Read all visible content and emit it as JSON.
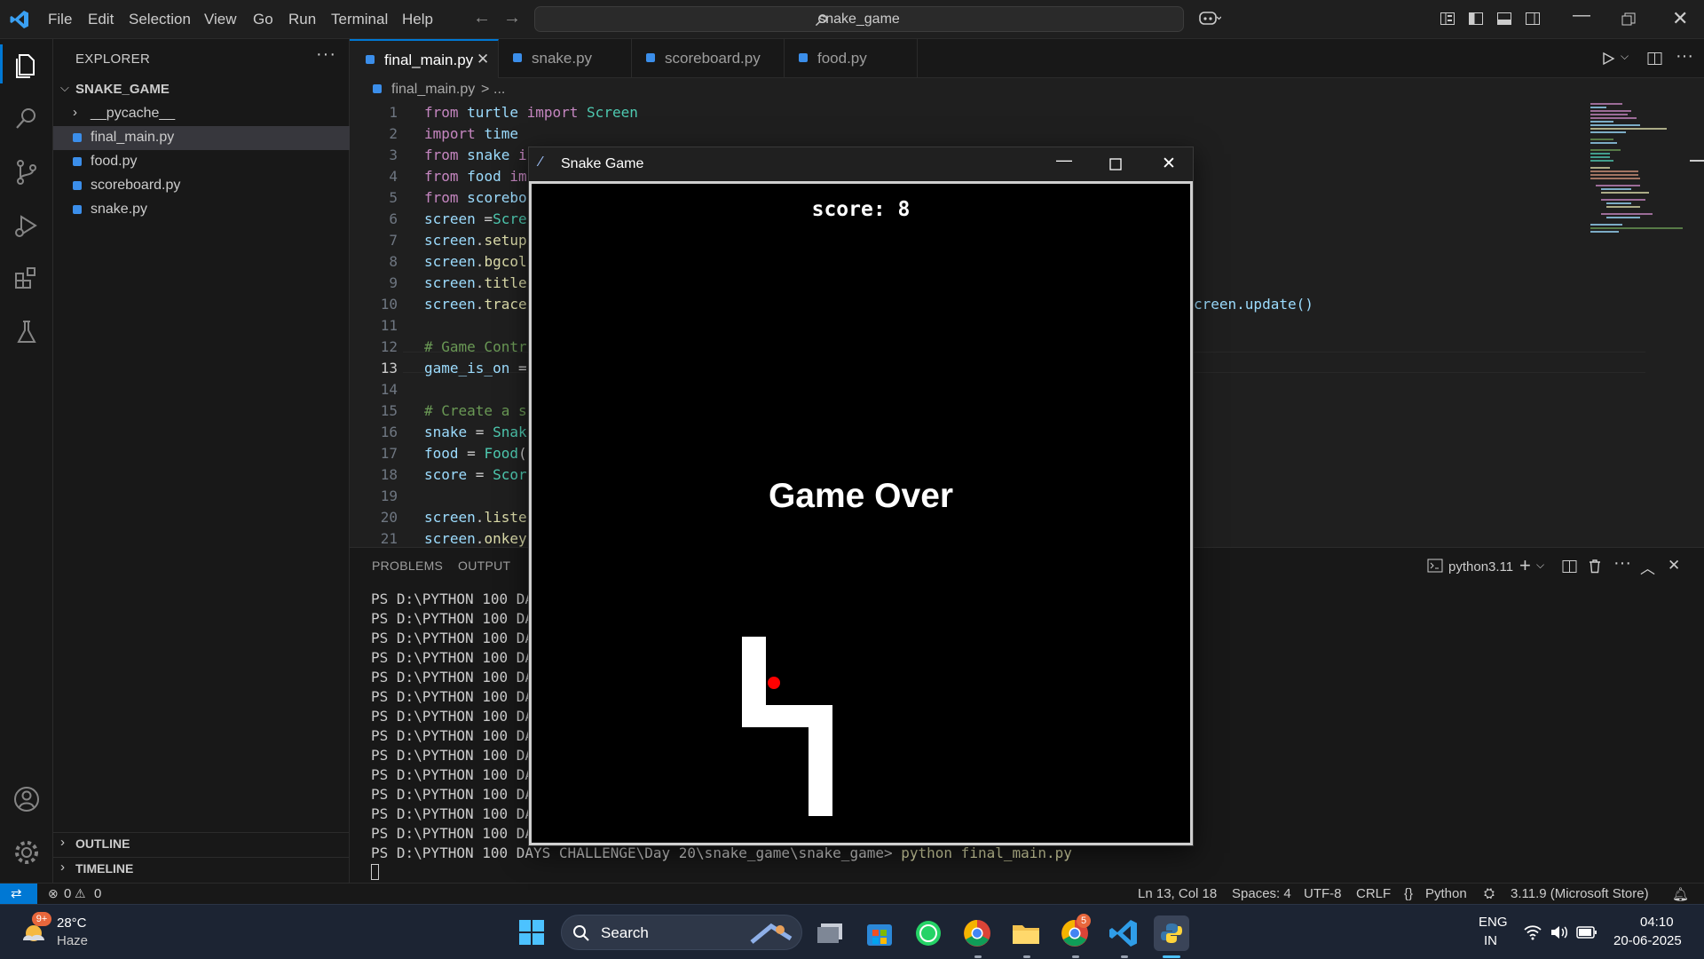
{
  "titlebar": {
    "menu": [
      "File",
      "Edit",
      "Selection",
      "View",
      "Go",
      "Run",
      "Terminal",
      "Help"
    ],
    "search_text": "snake_game"
  },
  "sidebar": {
    "title": "EXPLORER",
    "folder": "SNAKE_GAME",
    "items": [
      {
        "label": "__pycache__",
        "type": "folder"
      },
      {
        "label": "final_main.py",
        "type": "file",
        "selected": true
      },
      {
        "label": "food.py",
        "type": "file"
      },
      {
        "label": "scoreboard.py",
        "type": "file"
      },
      {
        "label": "snake.py",
        "type": "file"
      }
    ],
    "outline": "OUTLINE",
    "timeline": "TIMELINE"
  },
  "tabs": [
    {
      "label": "final_main.py",
      "active": true
    },
    {
      "label": "snake.py"
    },
    {
      "label": "scoreboard.py"
    },
    {
      "label": "food.py"
    }
  ],
  "breadcrumb": {
    "file": "final_main.py",
    "sep": ">",
    "rest": "..."
  },
  "editor": {
    "current_line": 13,
    "right_fragment": "creen.update()"
  },
  "panel": {
    "tabs": [
      "PROBLEMS",
      "OUTPUT"
    ],
    "terminal_name": "python3.11",
    "term_prefix": "PS D:\\PYTHON 100 DAY",
    "last_prompt": "PS D:\\PYTHON 100 DAYS CHALLENGE\\Day 20\\snake_game\\snake_game>",
    "last_command": "python final_main.py"
  },
  "statusbar": {
    "errors": "0",
    "warnings": "0",
    "position": "Ln 13, Col 18",
    "spaces": "Spaces: 4",
    "encoding": "UTF-8",
    "eol": "CRLF",
    "language": "Python",
    "interpreter": "3.11.9 (Microsoft Store)"
  },
  "snake_window": {
    "title": "Snake Game",
    "score_text": "score: 8",
    "game_over_text": "Game Over"
  },
  "taskbar": {
    "weather_temp": "28°C",
    "weather_desc": "Haze",
    "weather_badge": "9+",
    "search_label": "Search",
    "lang_top": "ENG",
    "lang_bottom": "IN",
    "time": "04:10",
    "date": "20-06-2025",
    "chrome_badge": "5"
  },
  "colors": {
    "accent": "#0078d4",
    "editor_bg": "#1f1f1f",
    "sidebar_bg": "#181818",
    "food": "#ff0000",
    "snake": "#ffffff"
  }
}
